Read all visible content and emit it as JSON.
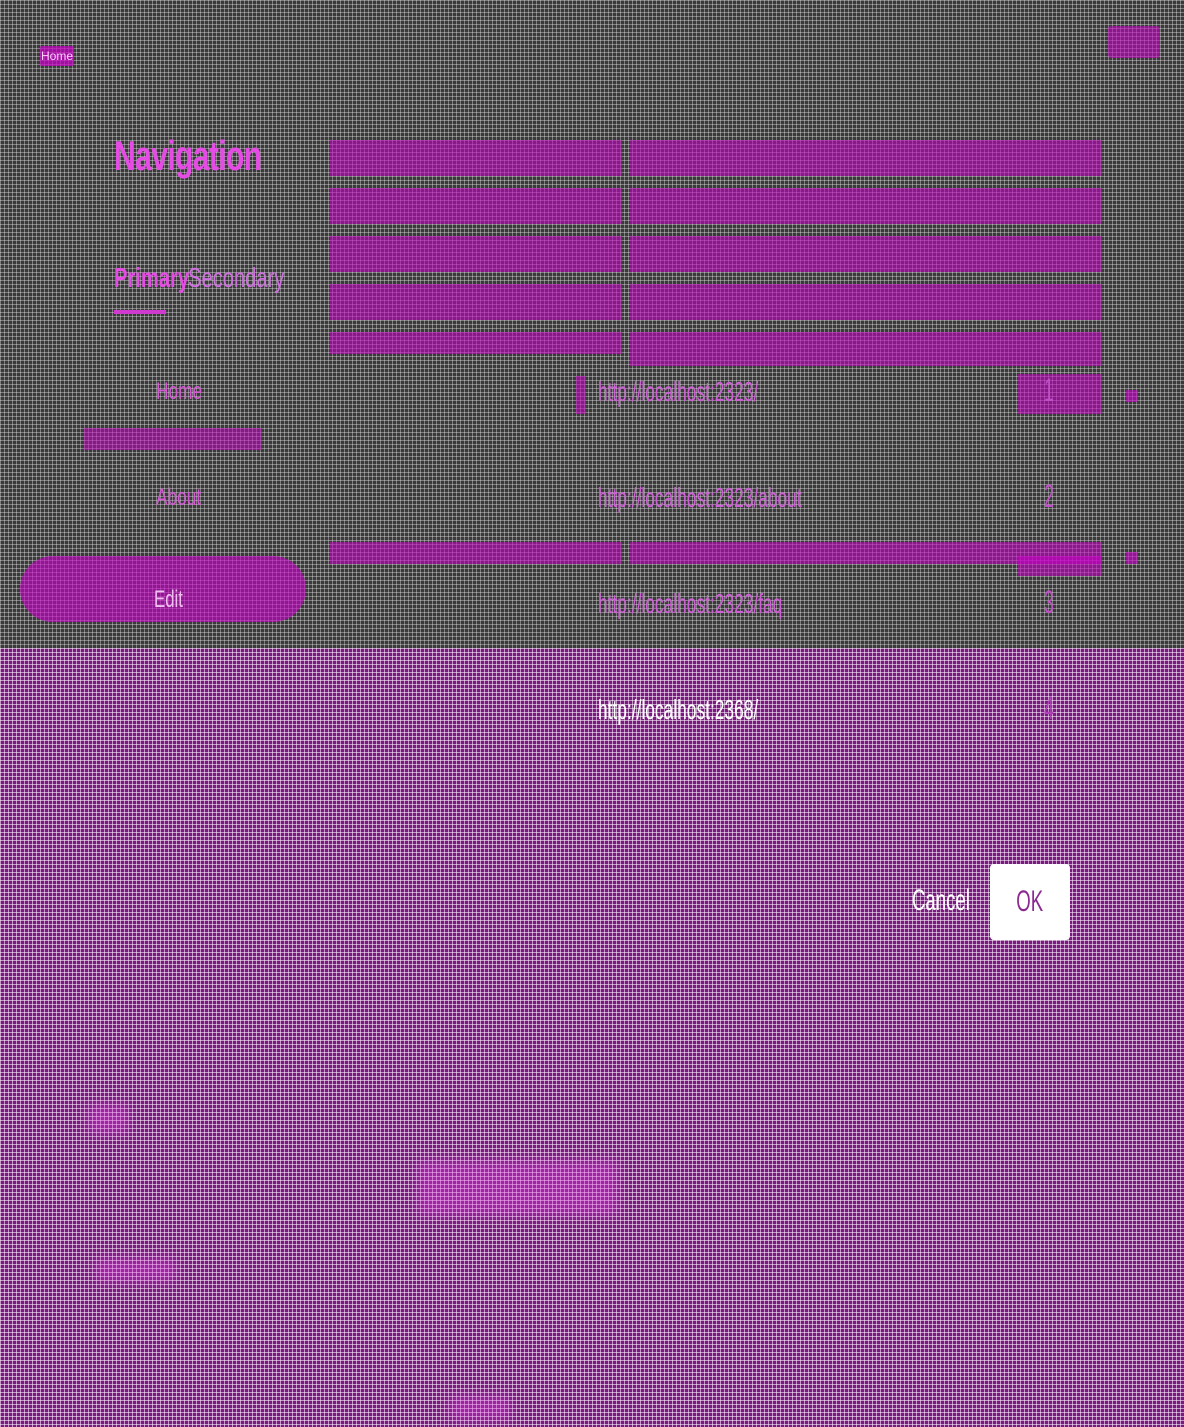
{
  "header": {
    "home_label": "Home"
  },
  "navigation": {
    "title": "Navigation",
    "tabs": [
      {
        "label": "Primary"
      },
      {
        "label": "Secondary"
      }
    ],
    "items": [
      {
        "label": "Home"
      },
      {
        "label": "About"
      }
    ],
    "pill_label": "Edit"
  },
  "links": [
    {
      "url": "http://localhost:2323/",
      "number": "1"
    },
    {
      "url": "http://localhost:2323/about",
      "number": "2"
    },
    {
      "url": "http://localhost:2323/faq",
      "number": "3"
    },
    {
      "url": "http://localhost:2368/",
      "number": "4"
    }
  ],
  "dialog": {
    "cancel_label": "Cancel",
    "ok_label": "OK"
  },
  "colors": {
    "accent": "#e64be6",
    "overlay": "#7a1a80",
    "panel": "#3a3a3a"
  }
}
